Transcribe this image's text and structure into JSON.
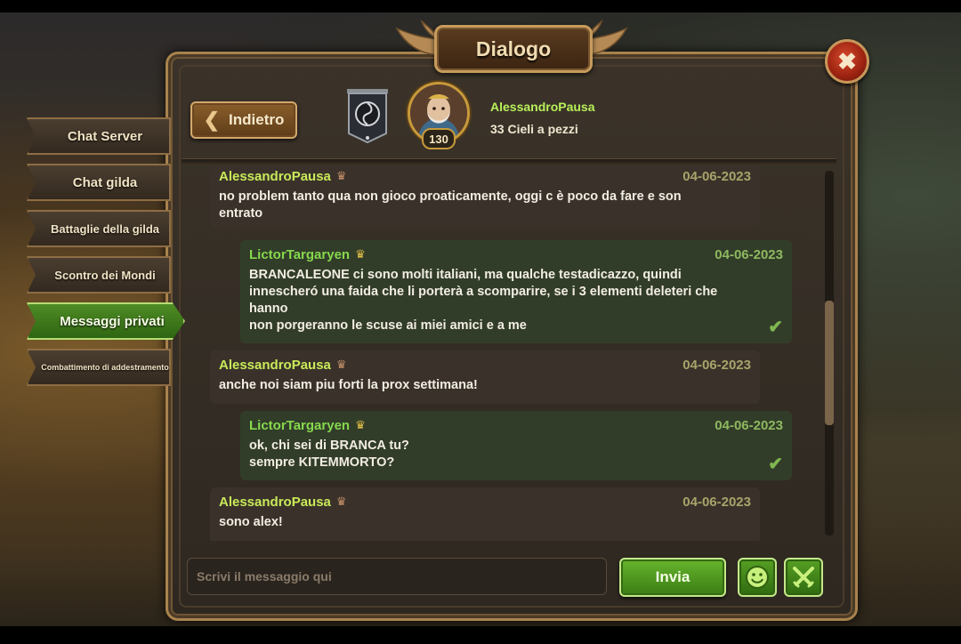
{
  "window": {
    "title": "Dialogo",
    "close_icon": "close-icon"
  },
  "tabs": [
    {
      "label": "Chat Server",
      "active": false
    },
    {
      "label": "Chat gilda",
      "active": false
    },
    {
      "label": "Battaglie della gilda",
      "active": false
    },
    {
      "label": "Scontro dei Mondi",
      "active": false
    },
    {
      "label": "Messaggi privati",
      "active": true
    },
    {
      "label": "Combattimento di addestramento",
      "active": false
    }
  ],
  "header": {
    "back_label": "Indietro",
    "player_name": "AlessandroPausa",
    "guild_name": "33 Cieli a pezzi",
    "level": "130"
  },
  "messages": [
    {
      "author": "AlessandroPausa",
      "date": "04-06-2023",
      "text": "no problem tanto qua non gioco proaticamente, oggi c è poco da fare e son\nentrato",
      "side": "them"
    },
    {
      "author": "LictorTargaryen",
      "date": "04-06-2023",
      "text": "BRANCALEONE ci sono molti italiani, ma qualche testadicazzo, quindi\ninnescheró una faida che li porterà a scomparire, se i 3 elementi deleteri che\nhanno\nnon porgeranno le scuse ai miei amici e a me",
      "side": "me",
      "read": true
    },
    {
      "author": "AlessandroPausa",
      "date": "04-06-2023",
      "text": "anche noi siam piu forti la prox settimana!",
      "side": "them"
    },
    {
      "author": "LictorTargaryen",
      "date": "04-06-2023",
      "text": "ok, chi sei di BRANCA tu?\nsempre KITEMMORTO?",
      "side": "me",
      "read": true
    },
    {
      "author": "AlessandroPausa",
      "date": "04-06-2023",
      "text": "sono alex!",
      "side": "them"
    }
  ],
  "composer": {
    "placeholder": "Scrivi il messaggio qui",
    "send_label": "Invia"
  },
  "colors": {
    "accent_green": "#4f8c25",
    "frame_gold": "#a8824d",
    "name_green": "#86d84d",
    "name_yellow": "#c9ea5a"
  }
}
